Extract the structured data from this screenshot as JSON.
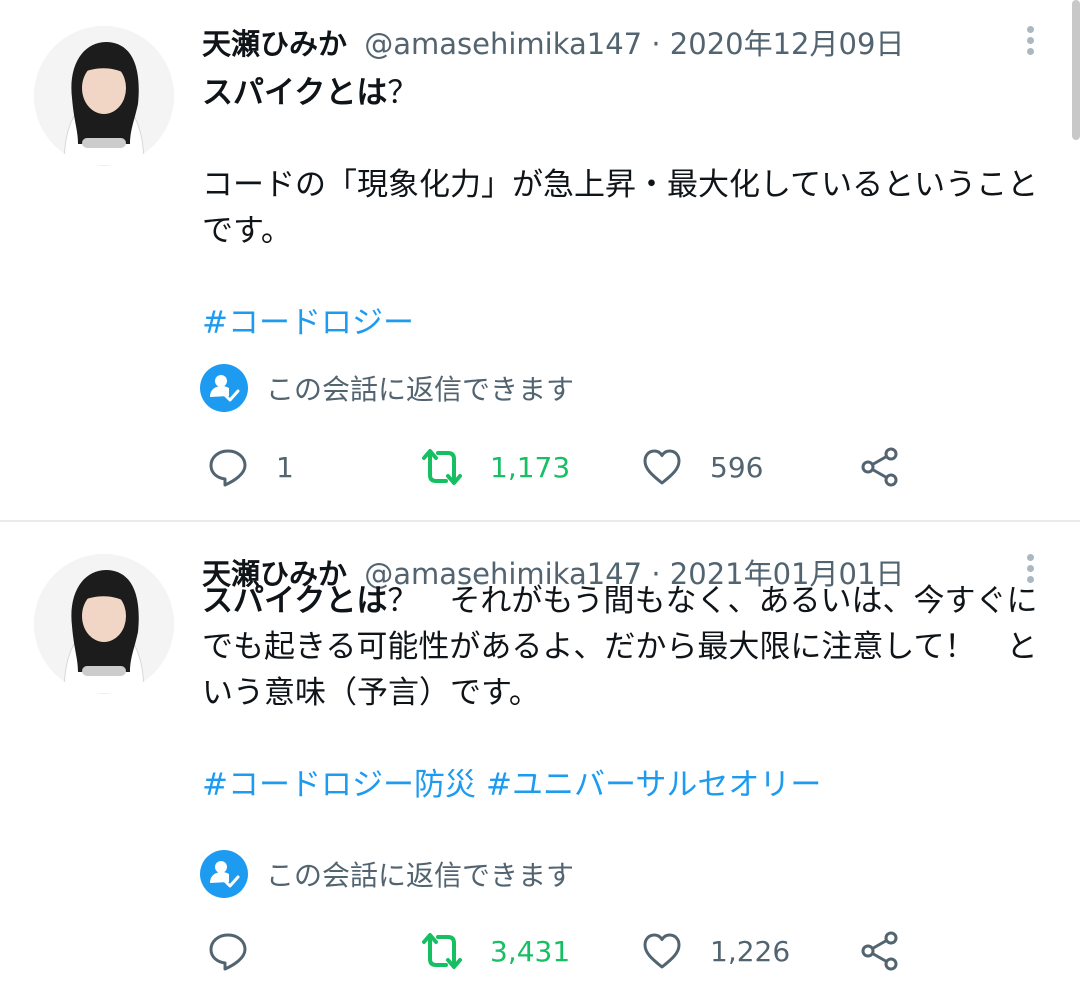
{
  "tweets": [
    {
      "author_name": "天瀬ひみか",
      "handle": "@amasehimika147",
      "separator": "·",
      "date": "2020年12月09日",
      "text_bold": "スパイクとは",
      "text_after_bold": "？",
      "paragraph": "コードの「現象化力」が急上昇・最大化しているということです。",
      "hashtags": [
        "#コードロジー"
      ],
      "reply_note": "この会話に返信できます",
      "replies": "1",
      "retweets": "1,173",
      "likes": "596"
    },
    {
      "author_name": "天瀬ひみか",
      "handle": "@amasehimika147",
      "separator": "·",
      "date": "2021年01月01日",
      "text_bold": "スパイクとは",
      "text_after_bold": "？　それがもう間もなく、あるいは、今すぐにでも起きる可能性があるよ、だから最大限に注意して！　という意味（予言）です。",
      "hashtags": [
        "#コードロジー防災",
        "#ユニバーサルセオリー"
      ],
      "reply_note": "この会話に返信できます",
      "replies": "",
      "retweets": "3,431",
      "likes": "1,226"
    }
  ],
  "colors": {
    "link": "#1d9bf0",
    "retweet": "#17bf63",
    "muted": "#536471",
    "text": "#0f1419"
  },
  "icons": [
    "reply-icon",
    "retweet-icon",
    "like-icon",
    "share-icon",
    "more-options-icon",
    "conversation-restricted-icon"
  ]
}
